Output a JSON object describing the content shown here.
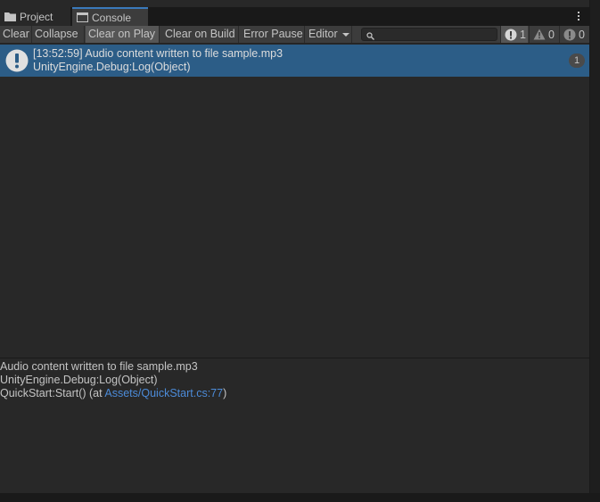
{
  "tabs": [
    {
      "label": "Project",
      "icon": "folder-icon"
    },
    {
      "label": "Console",
      "icon": "console-icon"
    }
  ],
  "toolbar": {
    "clear": "Clear",
    "collapse": "Collapse",
    "clear_on_play": "Clear on Play",
    "clear_on_build": "Clear on Build",
    "error_pause": "Error Pause",
    "editor": "Editor",
    "search_value": "",
    "log_count": "1",
    "warning_count": "0",
    "error_count": "0"
  },
  "log_entries": [
    {
      "line1": "[13:52:59] Audio content written to file sample.mp3",
      "line2": "UnityEngine.Debug:Log(Object)",
      "count": "1"
    }
  ],
  "detail": {
    "line1": "Audio content written to file sample.mp3",
    "line2": "UnityEngine.Debug:Log(Object)",
    "line3_prefix": "QuickStart:Start() (at ",
    "line3_link": "Assets/QuickStart.cs:77",
    "line3_suffix": ")"
  },
  "colors": {
    "selected_row": "#2c5d87",
    "link": "#4c8bd8",
    "active_tab_accent": "#3a79bb"
  }
}
